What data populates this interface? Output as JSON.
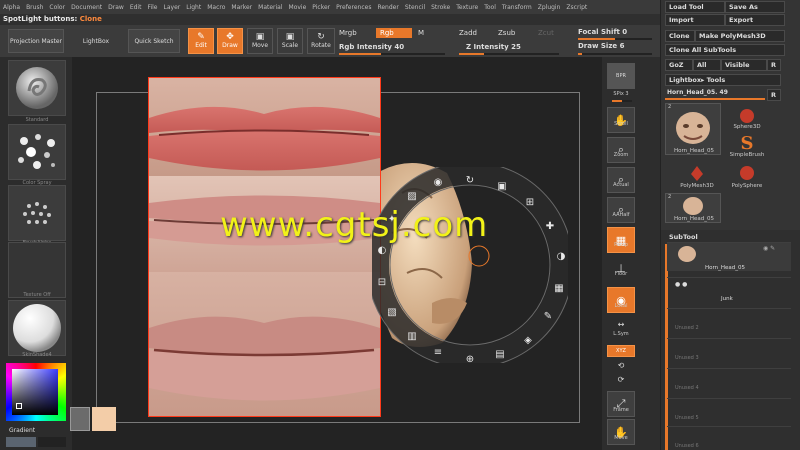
{
  "menu": [
    "Alpha",
    "Brush",
    "Color",
    "Document",
    "Draw",
    "Edit",
    "File",
    "Layer",
    "Light",
    "Macro",
    "Marker",
    "Material",
    "Movie",
    "Picker",
    "Preferences",
    "Render",
    "Stencil",
    "Stroke",
    "Texture",
    "Tool",
    "Transform",
    "Zplugin",
    "Zscript"
  ],
  "notice": {
    "prefix": "SpotLight buttons:",
    "value": "Clone"
  },
  "toolbar": {
    "projection_master": "Projection Master",
    "lightbox": "LightBox",
    "quick_sketch": "Quick Sketch",
    "edit": "Edit",
    "draw": "Draw",
    "move": "Move",
    "scale": "Scale",
    "rotate": "Rotate",
    "mrgb": "Mrgb",
    "rgb": "Rgb",
    "m": "M",
    "rgb_intensity": "Rgb Intensity 40",
    "zadd": "Zadd",
    "zsub": "Zsub",
    "zcut": "Zcut",
    "z_intensity": "Z Intensity 25",
    "focal_shift": "Focal Shift 0",
    "draw_size": "Draw Size 6"
  },
  "sliders": {
    "rgb_intensity": 0.4,
    "z_intensity": 0.25,
    "focal_shift": 0.5,
    "draw_size": 0.06
  },
  "left_shelf": {
    "brush": "Standard",
    "stroke": "Color Spray",
    "alpha": "BrushAlpha",
    "texture": "Texture Off",
    "material": "SkinShade4",
    "gradient": "Gradient"
  },
  "watermark": "www.cgtsj.com",
  "right_shelf": {
    "bpr": "BPR",
    "spix": "SPix 3",
    "scroll": "Scroll",
    "zoom": "Zoom",
    "actual": "Actual",
    "aahalf": "AAHalf",
    "persp": "Persp",
    "floor": "Floor",
    "local": "Local",
    "lsym": "L.Sym",
    "xyz": "XYZ",
    "frame": "Frame",
    "move": "Move"
  },
  "tool_panel": {
    "load_tool": "Load Tool",
    "save_as": "Save As",
    "import": "Import",
    "export": "Export",
    "clone": "Clone",
    "make_polymesh": "Make PolyMesh3D",
    "clone_all": "Clone All SubTools",
    "goz": "GoZ",
    "all": "All",
    "visible": "Visible",
    "r": "R",
    "lightbox_tools": "Lightbox▸ Tools",
    "current_tool": "Horn_Head_05. 49",
    "tool_count": "2",
    "tools": [
      {
        "name": "Horn_Head_05"
      },
      {
        "name": "Sphere3D"
      },
      {
        "name": "SimpleBrush"
      },
      {
        "name": "PolyMesh3D"
      },
      {
        "name": "PolySphere"
      },
      {
        "name": "Horn_Head_05"
      }
    ]
  },
  "subtool": {
    "title": "SubTool",
    "items": [
      "Horn_Head_05",
      "Junk",
      "Unused 2",
      "Unused 3",
      "Unused 4",
      "Unused 5",
      "Unused 6"
    ]
  },
  "colors": {
    "accent": "#e8782a",
    "watermark": "#f2f218",
    "photo_border": "#ff3a1a"
  }
}
